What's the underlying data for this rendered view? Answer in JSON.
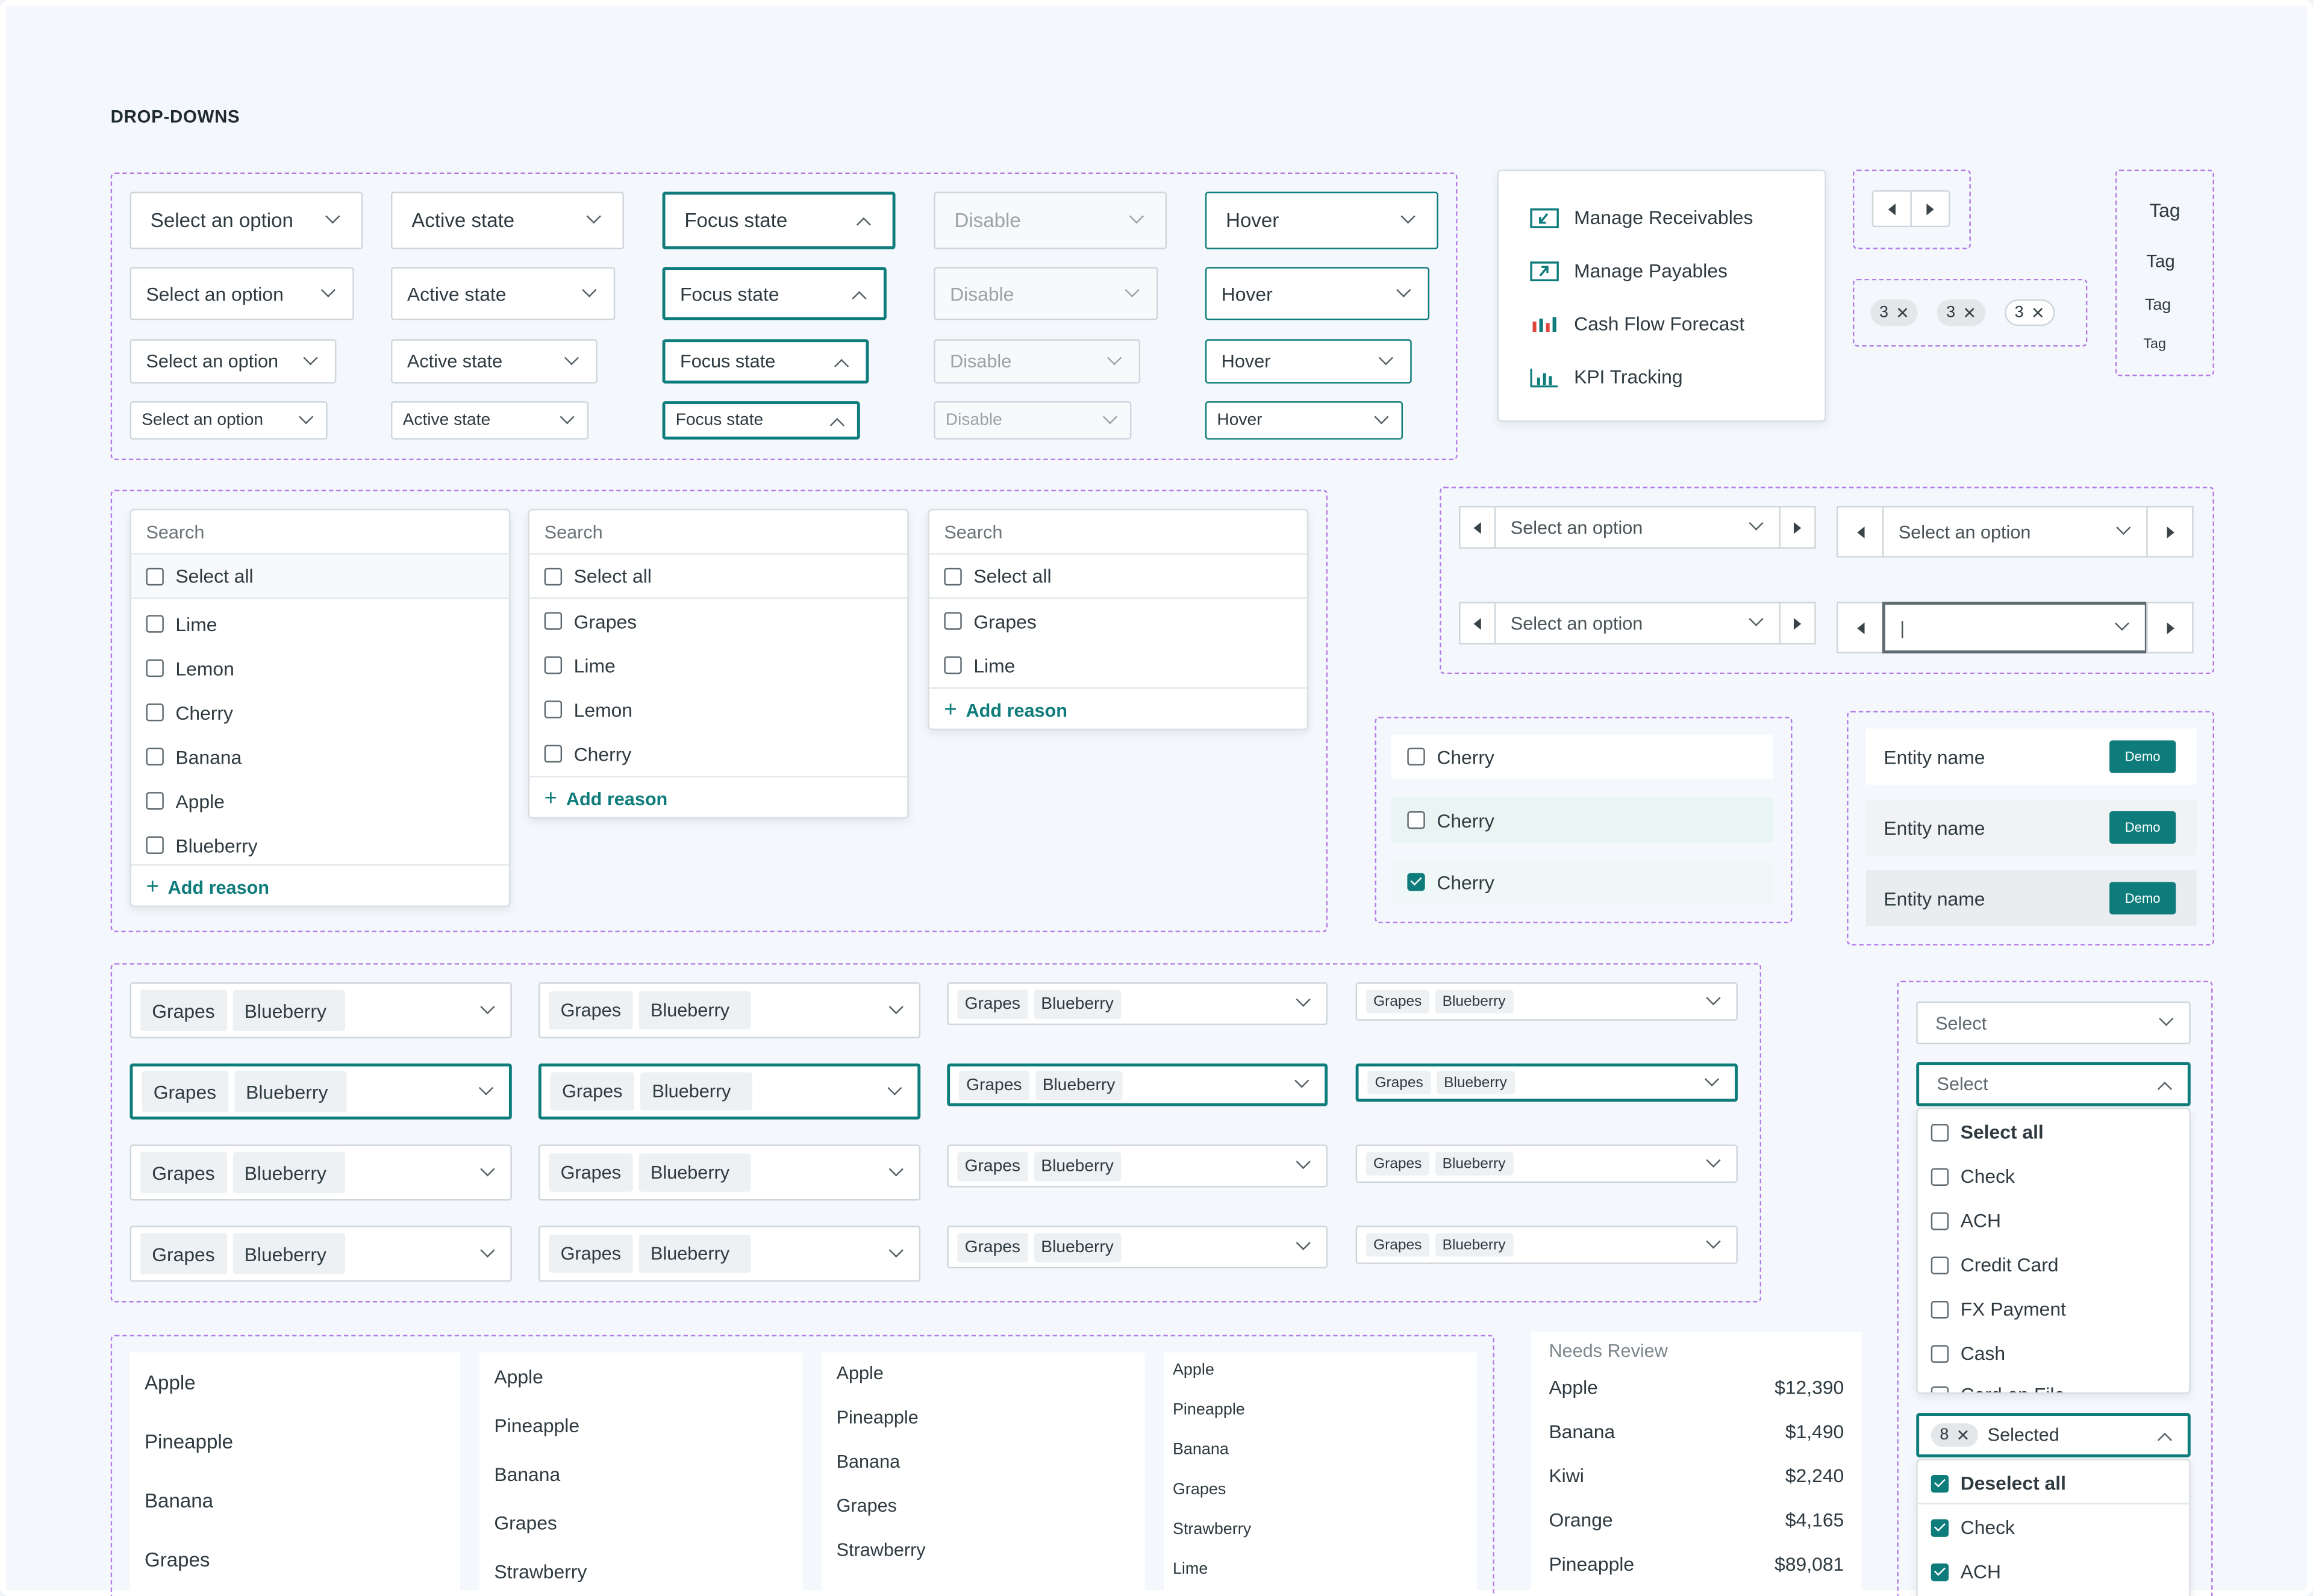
{
  "page_title": "DROP-DOWNS",
  "states": {
    "rows": [
      {
        "select": "Select an option",
        "active": "Active state",
        "focus": "Focus state",
        "disable": "Disable",
        "hover": "Hover"
      },
      {
        "select": "Select an option",
        "active": "Active state",
        "focus": "Focus state",
        "disable": "Disable",
        "hover": "Hover"
      },
      {
        "select": "Select an option",
        "active": "Active state",
        "focus": "Focus state",
        "disable": "Disable",
        "hover": "Hover"
      },
      {
        "select": "Select an option",
        "active": "Active state",
        "focus": "Focus state",
        "disable": "Disable",
        "hover": "Hover"
      }
    ]
  },
  "action_menu": {
    "items": [
      {
        "label": "Manage Receivables",
        "icon": "receivables-icon"
      },
      {
        "label": "Manage Payables",
        "icon": "payables-icon"
      },
      {
        "label": "Cash Flow Forecast",
        "icon": "forecast-chart-icon"
      },
      {
        "label": "KPI Tracking",
        "icon": "kpi-chart-icon"
      }
    ]
  },
  "count_chips": [
    "3",
    "3",
    "3"
  ],
  "tags": [
    "Tag",
    "Tag",
    "Tag",
    "Tag"
  ],
  "search_lists": [
    {
      "search": "Search",
      "select_all": "Select all",
      "items": [
        "Lime",
        "Lemon",
        "Cherry",
        "Banana",
        "Apple",
        "Blueberry"
      ],
      "add": "Add reason"
    },
    {
      "search": "Search",
      "select_all": "Select all",
      "items": [
        "Grapes",
        "Lime",
        "Lemon",
        "Cherry"
      ],
      "add": "Add reason"
    },
    {
      "search": "Search",
      "select_all": "Select all",
      "items": [
        "Grapes",
        "Lime"
      ],
      "add": "Add reason"
    }
  ],
  "steppers": {
    "placeholder": "Select an option",
    "cursor": "|"
  },
  "checkbox_rows": [
    {
      "label": "Cherry",
      "checked": false
    },
    {
      "label": "Cherry",
      "checked": false
    },
    {
      "label": "Cherry",
      "checked": true
    }
  ],
  "entities": [
    {
      "name": "Entity name",
      "badge": "Demo"
    },
    {
      "name": "Entity name",
      "badge": "Demo"
    },
    {
      "name": "Entity name",
      "badge": "Demo"
    }
  ],
  "multi": {
    "chip1": "Grapes",
    "chip2": "Blueberry"
  },
  "payment_select": {
    "placeholder": "Select",
    "select_all": "Select all",
    "options": [
      "Check",
      "ACH",
      "Credit Card",
      "FX Payment",
      "Cash",
      "Card on File"
    ],
    "selected_count": "8",
    "selected_label": "Selected",
    "deselect_all": "Deselect all",
    "selected_options": [
      "Check",
      "ACH"
    ]
  },
  "simple_lists": [
    [
      "Apple",
      "Pineapple",
      "Banana",
      "Grapes"
    ],
    [
      "Apple",
      "Pineapple",
      "Banana",
      "Grapes",
      "Strawberry"
    ],
    [
      "Apple",
      "Pineapple",
      "Banana",
      "Grapes",
      "Strawberry"
    ],
    [
      "Apple",
      "Pineapple",
      "Banana",
      "Grapes",
      "Strawberry",
      "Lime"
    ]
  ],
  "review": {
    "header": "Needs Review",
    "items": [
      {
        "name": "Apple",
        "amount": "$12,390"
      },
      {
        "name": "Banana",
        "amount": "$1,490"
      },
      {
        "name": "Kiwi",
        "amount": "$2,240"
      },
      {
        "name": "Orange",
        "amount": "$4,165"
      },
      {
        "name": "Pineapple",
        "amount": "$89,081"
      }
    ]
  },
  "colors": {
    "accent": "#0e7c7b",
    "guide": "#b57ae6",
    "background": "#f4f8fc"
  }
}
